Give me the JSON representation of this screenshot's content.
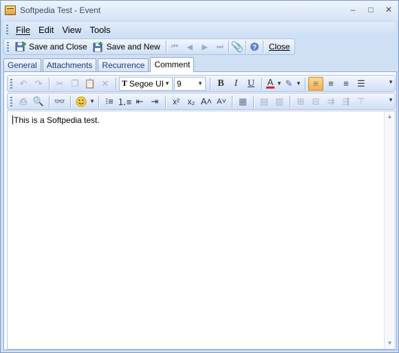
{
  "window": {
    "title": "Softpedia Test - Event",
    "minimize": "–",
    "maximize": "□",
    "close": "✕"
  },
  "menu": {
    "file": "File",
    "edit": "Edit",
    "view": "View",
    "tools": "Tools"
  },
  "toolbar": {
    "save_close": "Save and Close",
    "save_new": "Save and New",
    "close": "Close"
  },
  "tabs": [
    "General",
    "Attachments",
    "Recurrence",
    "Comment"
  ],
  "format": {
    "font": "Segoe UI",
    "size": "9"
  },
  "editor": {
    "text": "This is a Softpedia test."
  },
  "colors": {
    "accent": "#f6b04a",
    "frame": "#8aa6cf"
  }
}
